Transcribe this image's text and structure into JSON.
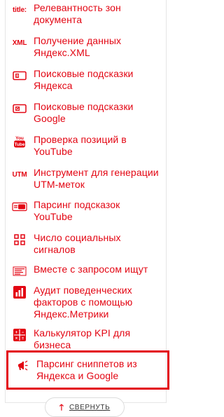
{
  "tools": [
    {
      "label": "Релевантность зон документа",
      "icon": "title-text-icon",
      "icon_text": "title:"
    },
    {
      "label": "Получение данных Яндекс.XML",
      "icon": "xml-text-icon",
      "icon_text": "XML"
    },
    {
      "label": "Поисковые подсказки Яндекса",
      "icon": "yandex-suggest-icon"
    },
    {
      "label": "Поисковые подсказки Google",
      "icon": "google-suggest-icon"
    },
    {
      "label": "Проверка позиций в YouTube",
      "icon": "youtube-icon"
    },
    {
      "label": "Инструмент для генерации UTM-меток",
      "icon": "utm-text-icon",
      "icon_text": "UTM"
    },
    {
      "label": "Парсинг подсказок YouTube",
      "icon": "youtube-suggest-icon"
    },
    {
      "label": "Число социальных сигналов",
      "icon": "social-signals-icon"
    },
    {
      "label": "Вместе с запросом ищут",
      "icon": "related-queries-icon"
    },
    {
      "label": "Аудит поведенческих факторов с помощью Яндекс.Метрики",
      "icon": "metrika-chart-icon"
    },
    {
      "label": "Калькулятор KPI для бизнеса",
      "icon": "calculator-icon"
    },
    {
      "label": "Парсинг сниппетов из Яндекса и Google",
      "icon": "megaphone-icon",
      "highlighted": true
    }
  ],
  "collapse": {
    "label": "СВЕРНУТЬ",
    "icon": "arrow-up-icon"
  },
  "colors": {
    "accent": "#e30613",
    "text": "#333333",
    "border": "#e6e6e6"
  }
}
